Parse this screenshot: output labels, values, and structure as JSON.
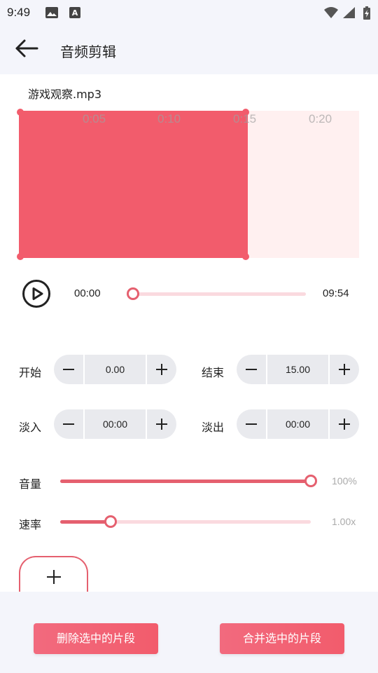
{
  "status_bar": {
    "time": "9:49",
    "icons": [
      "photo-icon",
      "text-a-icon",
      "wifi-icon",
      "signal-icon",
      "battery-charging-icon"
    ]
  },
  "app_bar": {
    "title": "音频剪辑",
    "back_icon": "arrow-left-icon"
  },
  "file": {
    "name": "游戏观察.mp3"
  },
  "waveform": {
    "ticks": [
      "0:05",
      "0:10",
      "0:15",
      "0:20"
    ],
    "selected_end_fraction": 0.67,
    "selection_color": "#f25c6c",
    "background_color": "#fff0f0"
  },
  "player": {
    "current_time": "00:00",
    "total_time": "09:54",
    "progress": 0.0,
    "play_icon": "play-circle-icon"
  },
  "params": {
    "start": {
      "label": "开始",
      "value": "0.00"
    },
    "end": {
      "label": "结束",
      "value": "15.00"
    },
    "fade_in": {
      "label": "淡入",
      "value": "00:00"
    },
    "fade_out": {
      "label": "淡出",
      "value": "00:00"
    }
  },
  "sliders": {
    "volume": {
      "label": "音量",
      "value_text": "100%",
      "level": 1.0
    },
    "speed": {
      "label": "速率",
      "value_text": "1.00x",
      "level": 0.2
    }
  },
  "actions": {
    "add_icon": "plus-icon",
    "delete_label": "删除选中的片段",
    "merge_label": "合并选中的片段"
  },
  "colors": {
    "accent": "#e5606f",
    "track": "#fadadf",
    "background": "#f4f5fb"
  }
}
